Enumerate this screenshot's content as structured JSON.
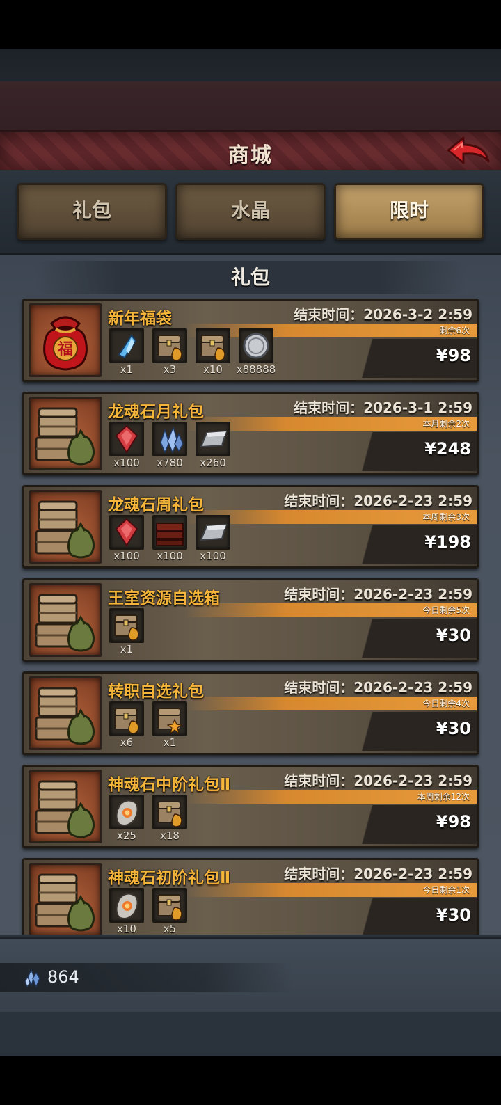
{
  "header": {
    "title": "商城"
  },
  "tabs": [
    {
      "label": "礼包",
      "active": false
    },
    {
      "label": "水晶",
      "active": false
    },
    {
      "label": "限时",
      "active": true
    }
  ],
  "section": {
    "title": "礼包"
  },
  "cards": [
    {
      "name": "新年福袋",
      "end": "结束时间：2026-3-2 2:59",
      "limit": "剩余6次",
      "price": "¥98",
      "image": "lucky-bag-icon",
      "items": [
        {
          "icon": "crystal-icon",
          "count": "x1"
        },
        {
          "icon": "chest-icon",
          "count": "x3"
        },
        {
          "icon": "chest-icon",
          "count": "x10"
        },
        {
          "icon": "silver-coin-icon",
          "count": "x88888"
        }
      ]
    },
    {
      "name": "龙魂石月礼包",
      "end": "结束时间：2026-3-1 2:59",
      "limit": "本月剩余2次",
      "price": "¥248",
      "image": "chest-stack-icon",
      "items": [
        {
          "icon": "red-gem-icon",
          "count": "x100"
        },
        {
          "icon": "blue-crystals-icon",
          "count": "x780"
        },
        {
          "icon": "iron-ingot-icon",
          "count": "x260"
        }
      ]
    },
    {
      "name": "龙魂石周礼包",
      "end": "结束时间：2026-2-23 2:59",
      "limit": "本周剩余3次",
      "price": "¥198",
      "image": "chest-stack-icon",
      "items": [
        {
          "icon": "red-gem-icon",
          "count": "x100"
        },
        {
          "icon": "wood-plank-icon",
          "count": "x100"
        },
        {
          "icon": "iron-ingot-icon",
          "count": "x100"
        }
      ]
    },
    {
      "name": "王室资源自选箱",
      "end": "结束时间：2026-2-23 2:59",
      "limit": "今日剩余5次",
      "price": "¥30",
      "image": "chest-stack-icon",
      "items": [
        {
          "icon": "chest-icon",
          "count": "x1"
        }
      ]
    },
    {
      "name": "转职自选礼包",
      "end": "结束时间：2026-2-23 2:59",
      "limit": "今日剩余4次",
      "price": "¥30",
      "image": "chest-stack-icon",
      "items": [
        {
          "icon": "chest-icon",
          "count": "x6"
        },
        {
          "icon": "star-chest-icon",
          "count": "x1"
        }
      ]
    },
    {
      "name": "神魂石中阶礼包Ⅱ",
      "end": "结束时间：2026-2-23 2:59",
      "limit": "本周剩余12次",
      "price": "¥98",
      "image": "chest-stack-icon",
      "items": [
        {
          "icon": "soul-stone-icon",
          "count": "x25"
        },
        {
          "icon": "chest-icon",
          "count": "x18"
        }
      ]
    },
    {
      "name": "神魂石初阶礼包Ⅱ",
      "end": "结束时间：2026-2-23 2:59",
      "limit": "今日剩余1次",
      "price": "¥30",
      "image": "chest-stack-icon",
      "items": [
        {
          "icon": "soul-stone-icon",
          "count": "x10"
        },
        {
          "icon": "chest-icon",
          "count": "x5"
        }
      ]
    }
  ],
  "footer": {
    "currency_icon": "crystal-icon",
    "currency_value": "864"
  }
}
